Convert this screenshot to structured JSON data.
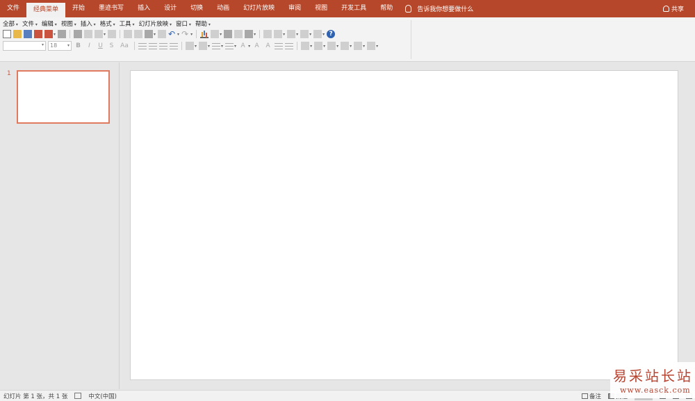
{
  "tabs": [
    {
      "label": "文件"
    },
    {
      "label": "经典菜单",
      "active": true
    },
    {
      "label": "开始"
    },
    {
      "label": "墨迹书写"
    },
    {
      "label": "插入"
    },
    {
      "label": "设计"
    },
    {
      "label": "切换"
    },
    {
      "label": "动画"
    },
    {
      "label": "幻灯片放映"
    },
    {
      "label": "审阅"
    },
    {
      "label": "视图"
    },
    {
      "label": "开发工具"
    },
    {
      "label": "帮助"
    }
  ],
  "tell_me": "告诉我你想要做什么",
  "share": "共享",
  "classic_menu": [
    "全部",
    "文件",
    "编辑",
    "视图",
    "插入",
    "格式",
    "工具",
    "幻灯片放映",
    "窗口",
    "帮助"
  ],
  "font_size": "18",
  "format_buttons": {
    "bold": "B",
    "italic": "I",
    "underline": "U",
    "shadow": "S",
    "case": "Aa"
  },
  "thumbnail": {
    "number": "1"
  },
  "status": {
    "slide_info": "幻灯片 第 1 张，共 1 张",
    "language": "中文(中国)",
    "notes": "备注",
    "comments": "批注"
  },
  "watermark": {
    "title": "易采站长站",
    "url": "www.easck.com"
  },
  "colors": {
    "accent": "#b7472a",
    "selection": "#e07a5f"
  }
}
